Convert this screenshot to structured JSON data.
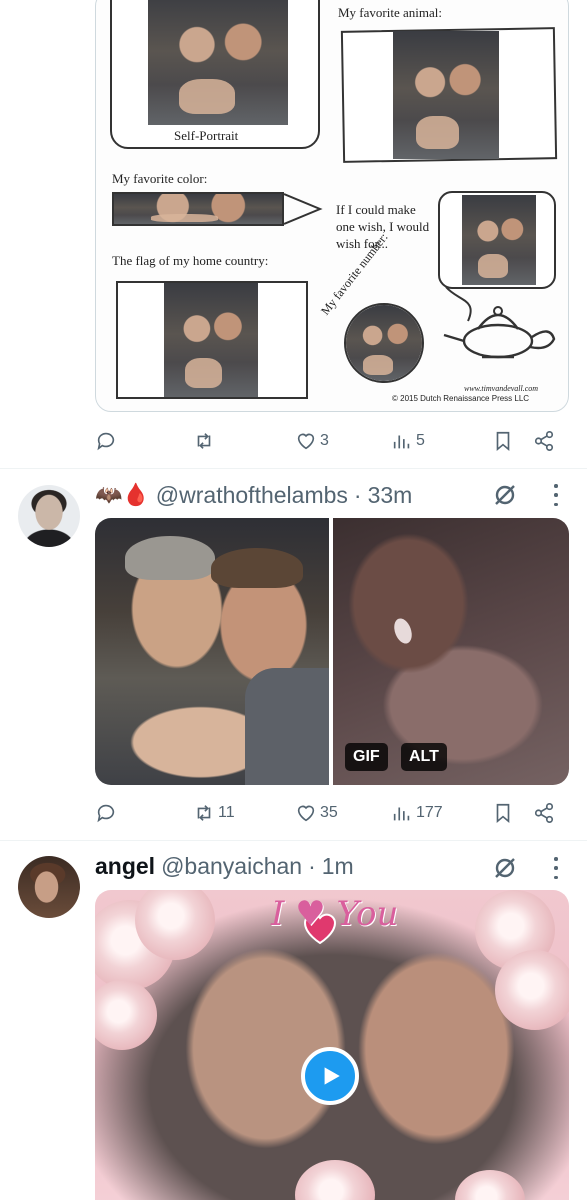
{
  "tweet1": {
    "worksheet": {
      "animal_label": "My favorite animal:",
      "self_portrait_label": "Self-Portrait",
      "color_label": "My favorite color:",
      "wish_label": "If I could make one wish, I would wish for...",
      "flag_label": "The flag of my home country:",
      "number_label": "My favorite number:",
      "website": "www.timvandevall.com",
      "copyright": "© 2015 Dutch Renaissance Press LLC"
    },
    "actions": {
      "reply": "",
      "retweet": "",
      "like": "3",
      "views": "5"
    }
  },
  "tweet2": {
    "display_emoji": "🦇🩸",
    "handle": "@wrathofthelambs",
    "separator": "·",
    "time": "33m",
    "media_badges": {
      "gif": "GIF",
      "alt": "ALT"
    },
    "actions": {
      "reply": "",
      "retweet": "11",
      "like": "35",
      "views": "177"
    }
  },
  "tweet3": {
    "name": "angel",
    "handle": "@banyaichan",
    "separator": "·",
    "time": "1m",
    "overlay_text": "I ♥ You"
  },
  "icons": [
    "reply-icon",
    "retweet-icon",
    "like-icon",
    "views-icon",
    "bookmark-icon",
    "share-icon",
    "grok-icon",
    "more-icon",
    "play-icon"
  ]
}
